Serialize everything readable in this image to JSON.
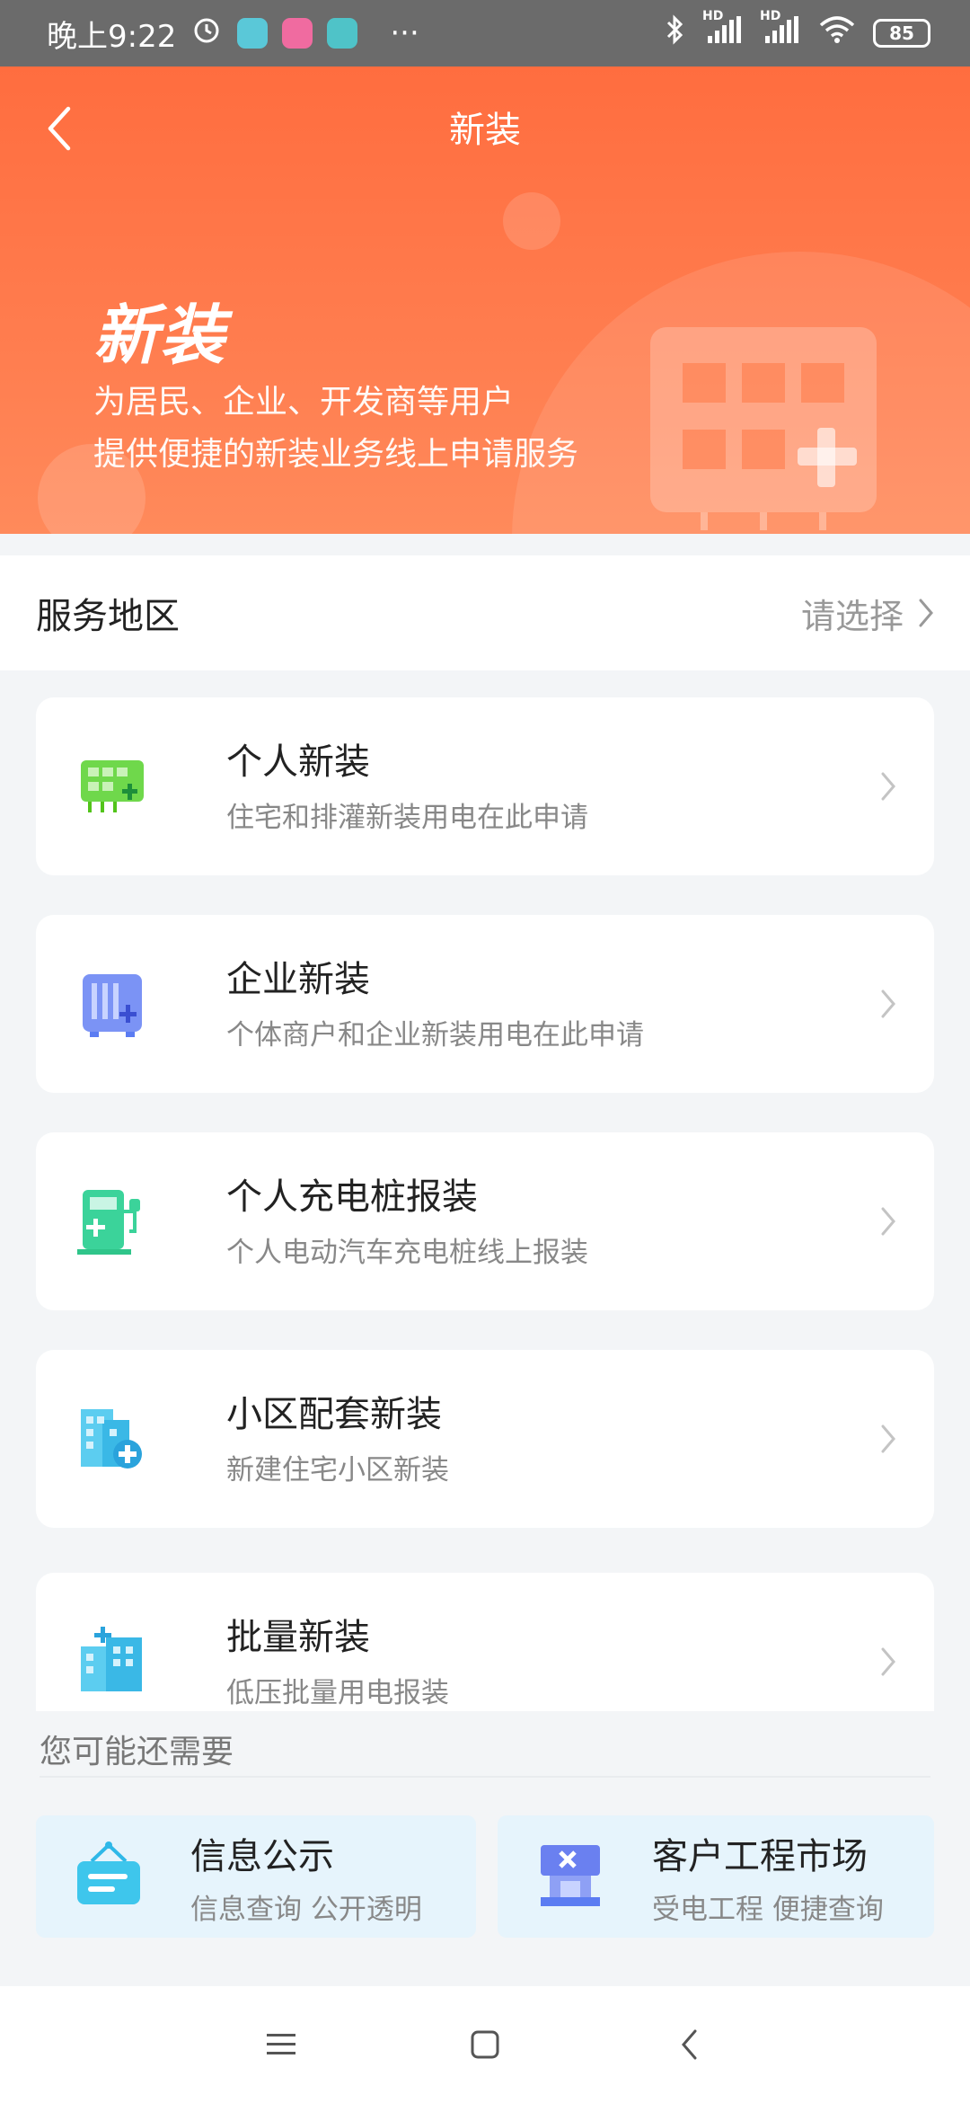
{
  "status_bar": {
    "time": "晚上9:22",
    "more": "···",
    "battery": "85",
    "signal_label_1": "HD",
    "signal_label_2": "HD"
  },
  "header": {
    "back_icon": "chevron-left-icon",
    "title": "新装"
  },
  "hero": {
    "title": "新装",
    "subtitle_line1": "为居民、企业、开发商等用户",
    "subtitle_line2": "提供便捷的新装业务线上申请服务"
  },
  "service_area": {
    "label": "服务地区",
    "value": "请选择"
  },
  "services": [
    {
      "title": "个人新装",
      "desc": "住宅和排灌新装用电在此申请",
      "icon": "house-meter-icon",
      "color": "#52c41a"
    },
    {
      "title": "企业新装",
      "desc": "个体商户和企业新装用电在此申请",
      "icon": "enterprise-cabinet-icon",
      "color": "#5b7cf2"
    },
    {
      "title": "个人充电桩报装",
      "desc": "个人电动汽车充电桩线上报装",
      "icon": "charging-pile-icon",
      "color": "#2fc58a"
    },
    {
      "title": "小区配套新装",
      "desc": "新建住宅小区新装",
      "icon": "residential-building-icon",
      "color": "#2fb8e8"
    },
    {
      "title": "批量新装",
      "desc": "低压批量用电报装",
      "icon": "batch-buildings-icon",
      "color": "#2fb8e8"
    }
  ],
  "more_section": {
    "title": "您可能还需要",
    "tiles": [
      {
        "title": "信息公示",
        "desc": "信息查询 公开透明",
        "icon": "notice-board-icon"
      },
      {
        "title": "客户工程市场",
        "desc": "受电工程 便捷查询",
        "icon": "engineering-market-icon"
      }
    ]
  },
  "colors": {
    "hero_gradient_start": "#ff6d3f",
    "hero_gradient_end": "#ff8a5b",
    "background": "#f3f5f7"
  }
}
